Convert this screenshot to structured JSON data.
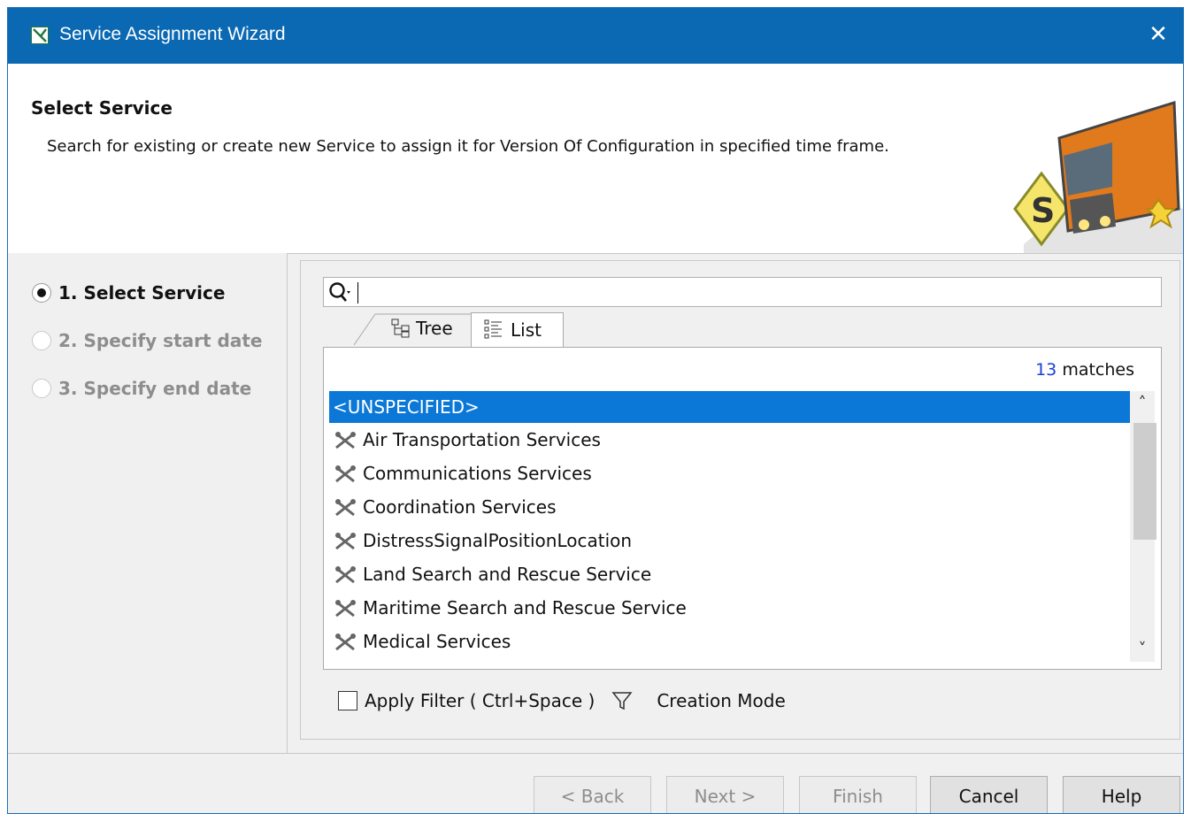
{
  "window": {
    "title": "Service Assignment Wizard",
    "close_icon": "close-icon"
  },
  "header": {
    "title": "Select Service",
    "description": "Search for existing or create new Service to assign it for Version Of Configuration in specified time frame."
  },
  "steps": [
    {
      "label": "1. Select Service",
      "selected": true
    },
    {
      "label": "2. Specify start date",
      "selected": false
    },
    {
      "label": "3. Specify end date",
      "selected": false
    }
  ],
  "search": {
    "value": "",
    "icon": "search-icon"
  },
  "tabs": [
    {
      "label": "Tree",
      "icon": "tree-icon",
      "active": false
    },
    {
      "label": "List",
      "icon": "list-icon",
      "active": true
    }
  ],
  "results": {
    "count": "13",
    "count_suffix": " matches",
    "items": [
      "<UNSPECIFIED>",
      "Air Transportation Services",
      "Communications Services",
      "Coordination Services",
      "DistressSignalPositionLocation",
      "Land Search and Rescue Service",
      "Maritime Search and Rescue Service",
      "Medical Services"
    ],
    "selected_index": 0,
    "item_icon": "service-icon"
  },
  "filter": {
    "apply_label": "Apply Filter ( Ctrl+Space )",
    "checked": false,
    "filter_icon": "filter-icon",
    "creation_mode_label": "Creation Mode"
  },
  "buttons": {
    "back": "< Back",
    "next": "Next >",
    "finish": "Finish",
    "cancel": "Cancel",
    "help": "Help"
  },
  "colors": {
    "titlebar": "#0b69b3",
    "selection": "#0b78d7",
    "match_count": "#1a3fd4"
  }
}
